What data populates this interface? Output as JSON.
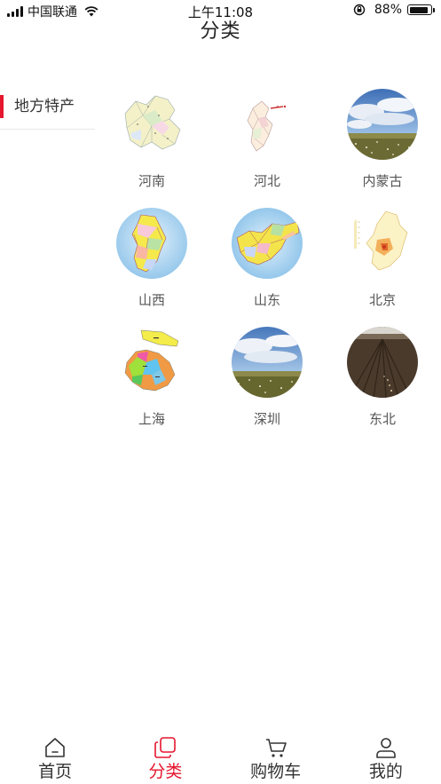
{
  "status_bar": {
    "carrier": "中国联通",
    "time": "上午11:08",
    "battery": "88%",
    "battery_level": 0.88
  },
  "header": {
    "title": "分类"
  },
  "sidebar": {
    "items": [
      {
        "label": "地方特产",
        "active": true
      }
    ]
  },
  "categories": [
    {
      "label": "河南",
      "icon": "henan-map-image"
    },
    {
      "label": "河北",
      "icon": "hebei-map-image"
    },
    {
      "label": "内蒙古",
      "icon": "grassland-photo"
    },
    {
      "label": "山西",
      "icon": "shanxi-map-image"
    },
    {
      "label": "山东",
      "icon": "shandong-map-image"
    },
    {
      "label": "北京",
      "icon": "beijing-map-image"
    },
    {
      "label": "上海",
      "icon": "shanghai-map-image"
    },
    {
      "label": "深圳",
      "icon": "grassland-photo"
    },
    {
      "label": "东北",
      "icon": "farmland-photo"
    }
  ],
  "tabbar": {
    "items": [
      {
        "label": "首页",
        "icon": "home-icon",
        "active": false
      },
      {
        "label": "分类",
        "icon": "category-icon",
        "active": true
      },
      {
        "label": "购物车",
        "icon": "cart-icon",
        "active": false
      },
      {
        "label": "我的",
        "icon": "user-icon",
        "active": false
      }
    ]
  },
  "colors": {
    "accent": "#e5162e",
    "text": "#333333",
    "divider": "#e8e8e8"
  }
}
